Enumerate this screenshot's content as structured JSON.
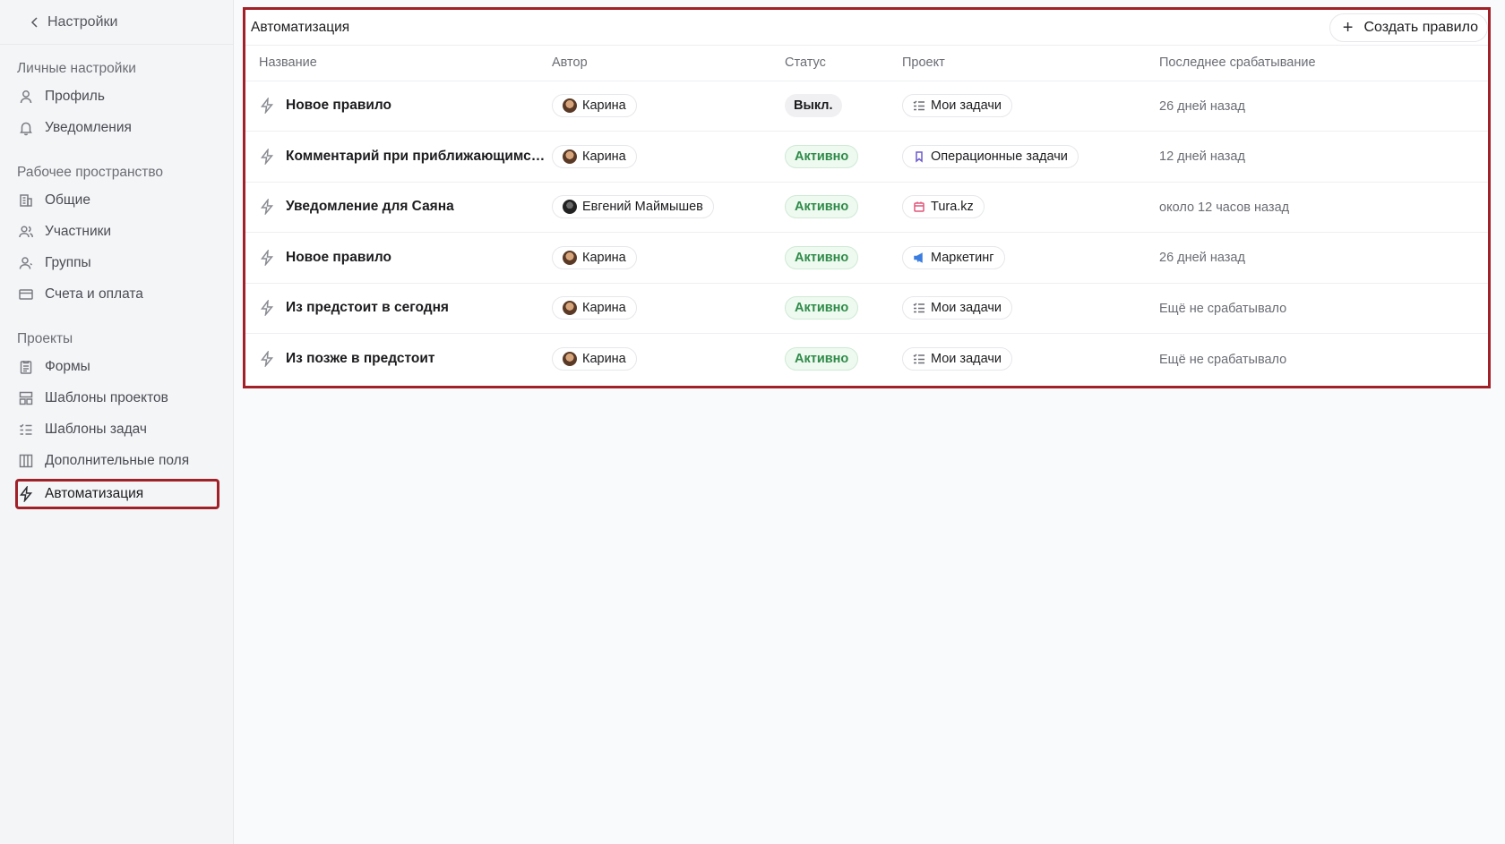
{
  "sidebar": {
    "back_label": "Настройки",
    "sections": [
      {
        "title": "Личные настройки",
        "items": [
          {
            "label": "Профиль",
            "icon": "user-icon"
          },
          {
            "label": "Уведомления",
            "icon": "bell-icon"
          }
        ]
      },
      {
        "title": "Рабочее пространство",
        "items": [
          {
            "label": "Общие",
            "icon": "building-icon"
          },
          {
            "label": "Участники",
            "icon": "users-icon"
          },
          {
            "label": "Группы",
            "icon": "group-icon"
          },
          {
            "label": "Счета и оплата",
            "icon": "card-icon"
          }
        ]
      },
      {
        "title": "Проекты",
        "items": [
          {
            "label": "Формы",
            "icon": "form-icon"
          },
          {
            "label": "Шаблоны проектов",
            "icon": "layout-icon"
          },
          {
            "label": "Шаблоны задач",
            "icon": "checklist-icon"
          },
          {
            "label": "Дополнительные поля",
            "icon": "columns-icon"
          },
          {
            "label": "Автоматизация",
            "icon": "lightning-icon",
            "active": true
          }
        ]
      }
    ]
  },
  "main": {
    "title": "Автоматизация",
    "create_label": "Создать правило",
    "columns": [
      "Название",
      "Автор",
      "Статус",
      "Проект",
      "Последнее срабатывание"
    ],
    "rows": [
      {
        "name": "Новое правило",
        "author": "Карина",
        "status": "Выкл.",
        "status_kind": "off",
        "project": "Мои задачи",
        "project_icon": "checklist-icon",
        "last": "26 дней назад"
      },
      {
        "name": "Комментарий при приближающимся...",
        "author": "Карина",
        "status": "Активно",
        "status_kind": "on",
        "project": "Операционные задачи",
        "project_icon": "bookmark-icon",
        "last": "12 дней назад"
      },
      {
        "name": "Уведомление для Саяна",
        "author": "Евгений Маймышев",
        "status": "Активно",
        "status_kind": "on",
        "project": "Tura.kz",
        "project_icon": "calendar-icon",
        "last": "около 12 часов назад"
      },
      {
        "name": "Новое правило",
        "author": "Карина",
        "status": "Активно",
        "status_kind": "on",
        "project": "Маркетинг",
        "project_icon": "megaphone-icon",
        "last": "26 дней назад"
      },
      {
        "name": "Из предстоит в сегодня",
        "author": "Карина",
        "status": "Активно",
        "status_kind": "on",
        "project": "Мои задачи",
        "project_icon": "checklist-icon",
        "last": "Ещё не срабатывало"
      },
      {
        "name": "Из позже в предстоит",
        "author": "Карина",
        "status": "Активно",
        "status_kind": "on",
        "project": "Мои задачи",
        "project_icon": "checklist-icon",
        "last": "Ещё не срабатывало"
      }
    ]
  },
  "colors": {
    "highlight": "#a02128",
    "status_on": "#2e8b48",
    "sidebar_bg": "#f4f5f7"
  }
}
